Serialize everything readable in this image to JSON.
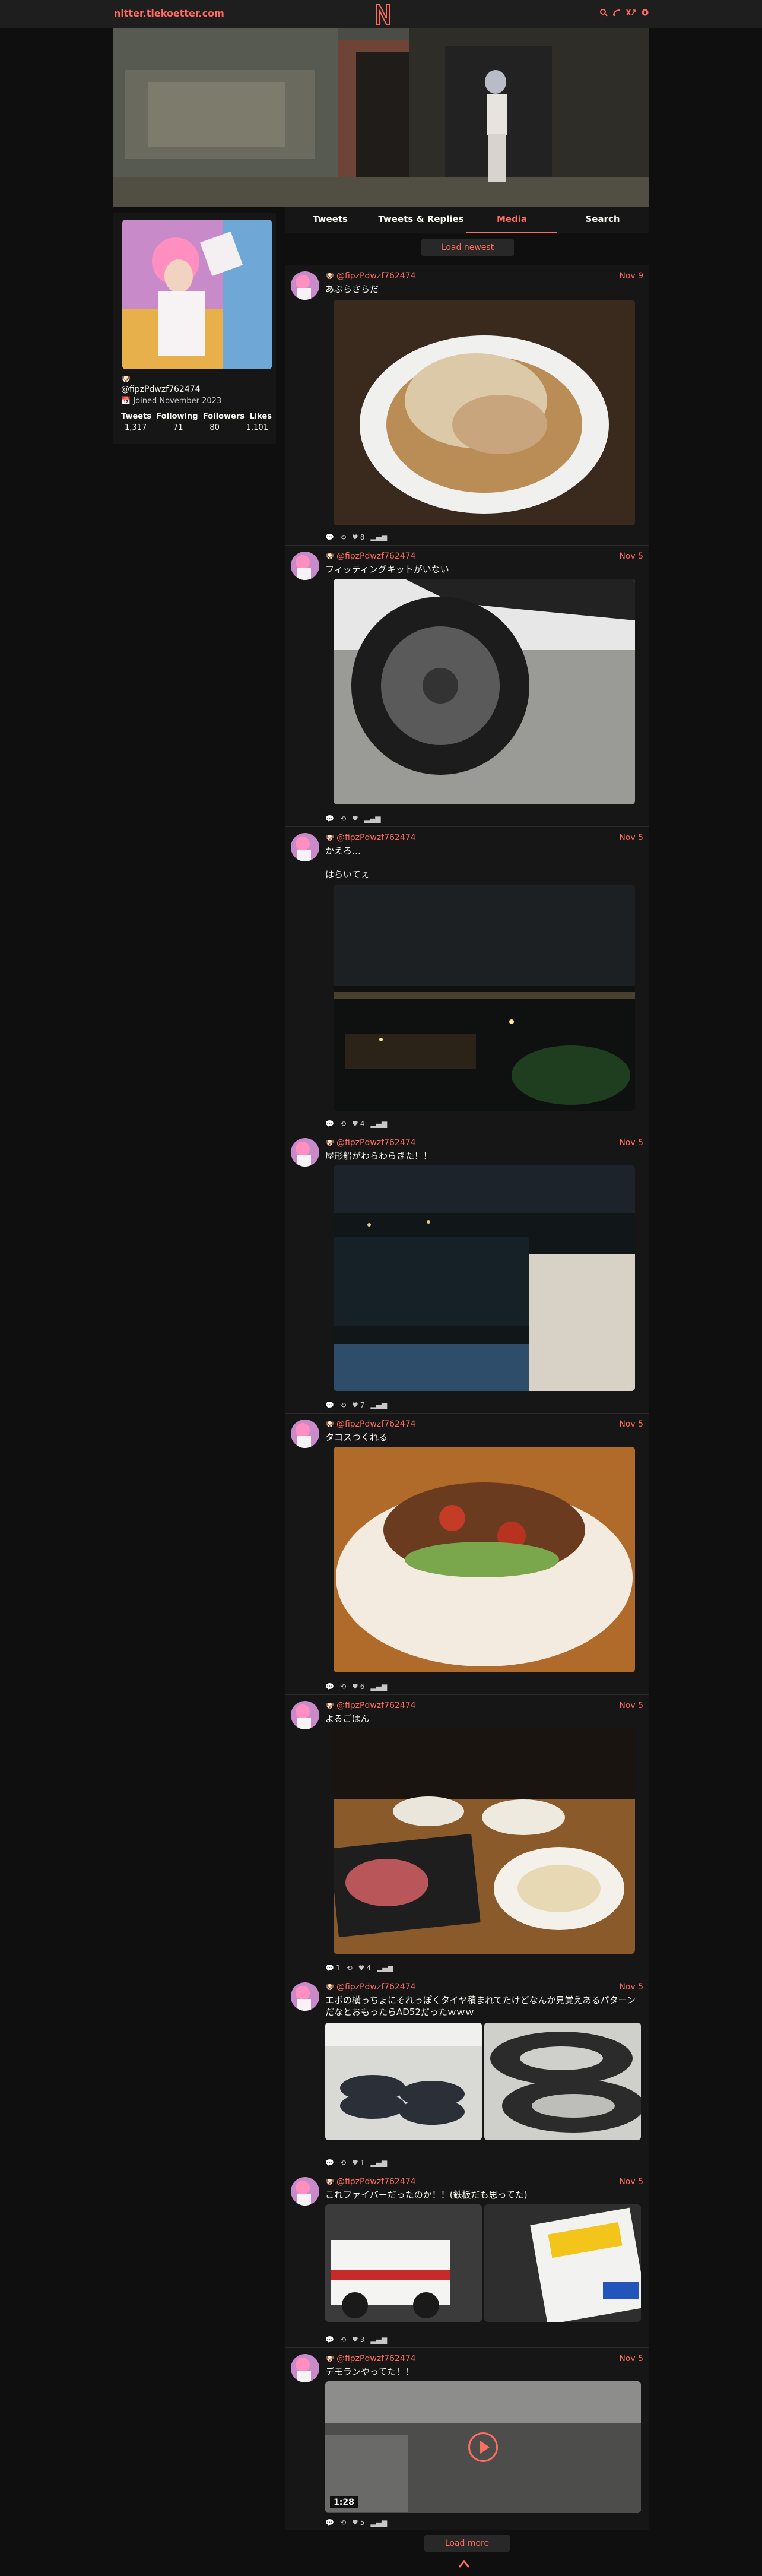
{
  "nav": {
    "site_name": "nitter.tiekoetter.com",
    "icons": [
      "search-icon",
      "rss-icon",
      "open-in-x-icon",
      "settings-icon"
    ]
  },
  "profile": {
    "glyph": "🐶",
    "handle": "@fipzPdwzf762474",
    "joined": "Joined November 2023",
    "stat_labels": [
      "Tweets",
      "Following",
      "Followers",
      "Likes"
    ],
    "stat_values": [
      "1,317",
      "71",
      "80",
      "1,101"
    ]
  },
  "tabs": [
    "Tweets",
    "Tweets & Replies",
    "Media",
    "Search"
  ],
  "active_tab": "Media",
  "load_newest": "Load newest",
  "load_more": "Load more",
  "colors": {
    "accent": "#ff6c60",
    "bg": "#0f0f0f",
    "card": "#161616"
  },
  "tweets": [
    {
      "glyph": "🐶",
      "handle": "@fipzPdwzf762474",
      "date": "Nov 9",
      "text": "あぶらさらだ",
      "stats": {
        "comments": "",
        "retweets": "",
        "likes": "8",
        "views": ""
      }
    },
    {
      "glyph": "🐶",
      "handle": "@fipzPdwzf762474",
      "date": "Nov 5",
      "text": "フィッティングキットがいない",
      "stats": {
        "comments": "",
        "retweets": "",
        "likes": "",
        "views": ""
      }
    },
    {
      "glyph": "🐶",
      "handle": "@fipzPdwzf762474",
      "date": "Nov 5",
      "text": "かえろ…\n\nはらいてぇ",
      "stats": {
        "comments": "",
        "retweets": "",
        "likes": "4",
        "views": ""
      }
    },
    {
      "glyph": "🐶",
      "handle": "@fipzPdwzf762474",
      "date": "Nov 5",
      "text": "屋形船がわらわらきた！！",
      "stats": {
        "comments": "",
        "retweets": "",
        "likes": "7",
        "views": ""
      }
    },
    {
      "glyph": "🐶",
      "handle": "@fipzPdwzf762474",
      "date": "Nov 5",
      "text": "タコスつくれる",
      "stats": {
        "comments": "",
        "retweets": "",
        "likes": "6",
        "views": ""
      }
    },
    {
      "glyph": "🐶",
      "handle": "@fipzPdwzf762474",
      "date": "Nov 5",
      "text": "よるごはん",
      "stats": {
        "comments": "1",
        "retweets": "",
        "likes": "4",
        "views": ""
      }
    },
    {
      "glyph": "🐶",
      "handle": "@fipzPdwzf762474",
      "date": "Nov 5",
      "text": "エボの横っちょにそれっぽくタイヤ積まれてたけどなんか見覚えあるパターンだなとおもったらAD52だったｗｗｗ",
      "stats": {
        "comments": "",
        "retweets": "",
        "likes": "1",
        "views": ""
      }
    },
    {
      "glyph": "🐶",
      "handle": "@fipzPdwzf762474",
      "date": "Nov 5",
      "text": "これファイバーだったのか！！(鉄板だも思ってた)",
      "stats": {
        "comments": "",
        "retweets": "",
        "likes": "3",
        "views": ""
      }
    },
    {
      "glyph": "🐶",
      "handle": "@fipzPdwzf762474",
      "date": "Nov 5",
      "text": "デモランやってた！！",
      "stats": {
        "comments": "",
        "retweets": "",
        "likes": "5",
        "views": ""
      },
      "video_duration": "1:28"
    }
  ]
}
